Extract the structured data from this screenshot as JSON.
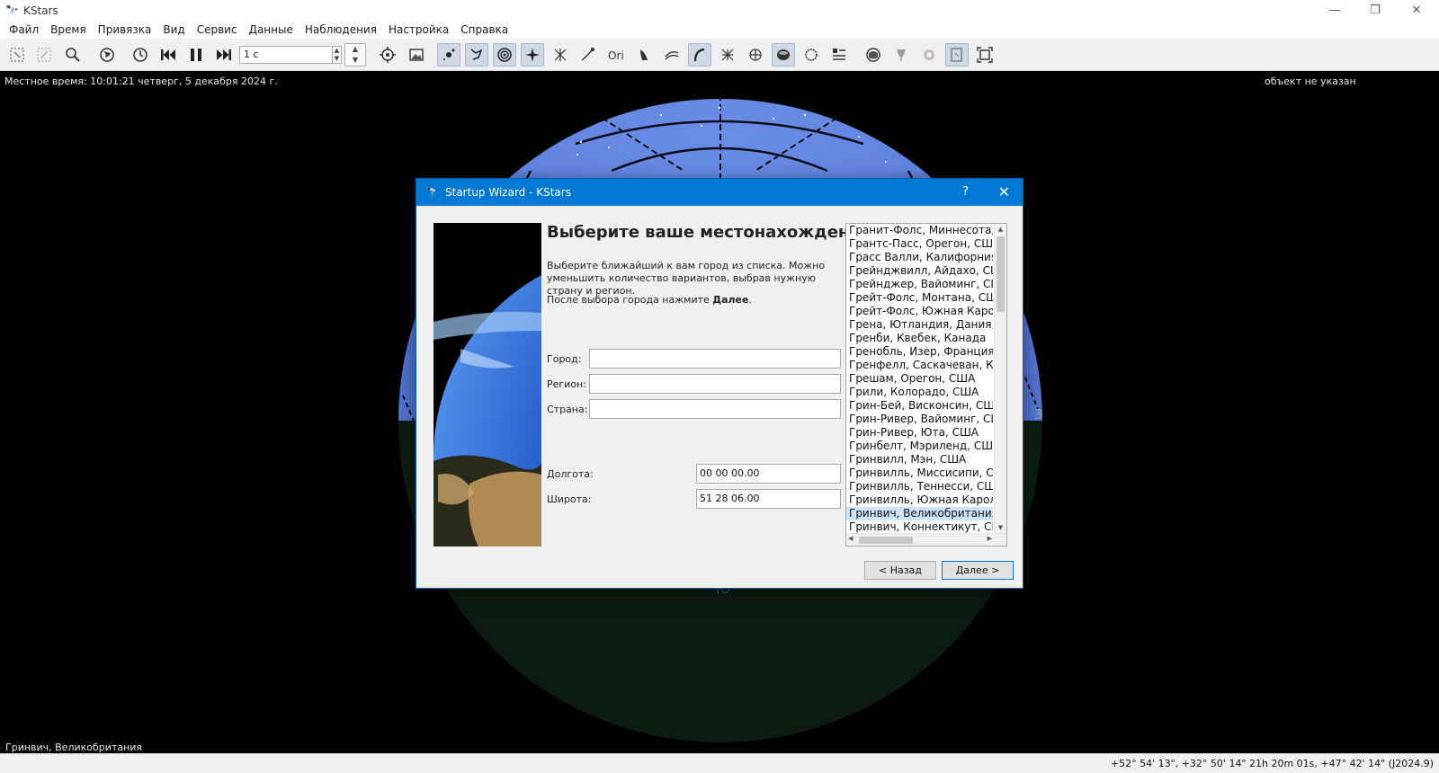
{
  "window": {
    "title": "KStars"
  },
  "menu": [
    "Файл",
    "Время",
    "Привязка",
    "Вид",
    "Сервис",
    "Данные",
    "Наблюдения",
    "Настройка",
    "Справка"
  ],
  "toolbar": {
    "speed_value": "1 с",
    "icons": [
      "select-icon",
      "zoom-fit-icon",
      "search-icon",
      "globe-icon",
      "clock-icon",
      "skip-back-icon",
      "pause-icon",
      "skip-forward-icon",
      "crosshair-icon",
      "image-icon",
      "stars-icon",
      "constellation-icon",
      "deep-sky-icon",
      "solar-system-icon",
      "supernova-icon",
      "asteroid-icon",
      "constellation-names-icon",
      "satellite-icon",
      "milky-way-icon",
      "equator-grid-icon",
      "horizontal-grid-icon",
      "horizon-icon",
      "ground-icon",
      "flags-icon",
      "observing-list-icon",
      "hips-icon",
      "telescope-icon",
      "ekos-icon",
      "fov-icon",
      "fullscreen-icon"
    ]
  },
  "sky": {
    "local_time": "Местное время: 10:01:21  четверг, 5 декабря 2024 г.",
    "object_info": "объект не указан",
    "location": "Гринвич, Великобритания",
    "compass_w": "З",
    "compass_s": "Ю"
  },
  "status": {
    "coords": "+52° 54' 13\", +32° 50' 14\"  21h 20m 01s, +47° 42' 14\" (J2024.9)"
  },
  "dialog": {
    "title": "Startup Wizard - KStars",
    "help": "?",
    "heading": "Выберите ваше местонахождение",
    "description": "Выберите ближайший к вам город из списка. Можно уменьшить количество вариантов, выбрав нужную страну и регион.",
    "hint_prefix": "После выбора города нажмите ",
    "hint_bold": "Далее",
    "hint_suffix": ".",
    "city_label": "Город:",
    "region_label": "Регион:",
    "country_label": "Страна:",
    "longitude_label": "Долгота:",
    "longitude_value": "00 00 00.00",
    "latitude_label": "Широта:",
    "latitude_value": "51 28 06.00",
    "back_button": "< Назад",
    "next_button": "Далее >",
    "cities": [
      "Гранит-Фолс, Миннесота, США",
      "Грантс-Пасс, Орегон, США",
      "Грасс Валли, Калифорния, США",
      "Грейнджвилл, Айдахо, США",
      "Грейнджер, Вайоминг, США",
      "Грейт-Фолс, Монтана, США",
      "Грейт-Фолс, Южная Каролина",
      "Грена, Ютландия, Дания",
      "Гренби, Квебек, Канада",
      "Гренобль, Изер, Франция",
      "Гренфелл, Саскачеван, Канада",
      "Грешам, Орегон, США",
      "Грили, Колорадо, США",
      "Грин-Бей, Висконсин, США",
      "Грин-Ривер, Вайоминг, США",
      "Грин-Ривер, Юта, США",
      "Гринбелт, Мэриленд, США",
      "Гринвилл, Мэн, США",
      "Гринвилль, Миссисипи, США",
      "Гринвилль, Теннесси, США",
      "Гринвилль, Южная Каролина",
      "Гринвич, Великобритания",
      "Гринвич, Коннектикут, США"
    ],
    "selected_index": 21
  }
}
